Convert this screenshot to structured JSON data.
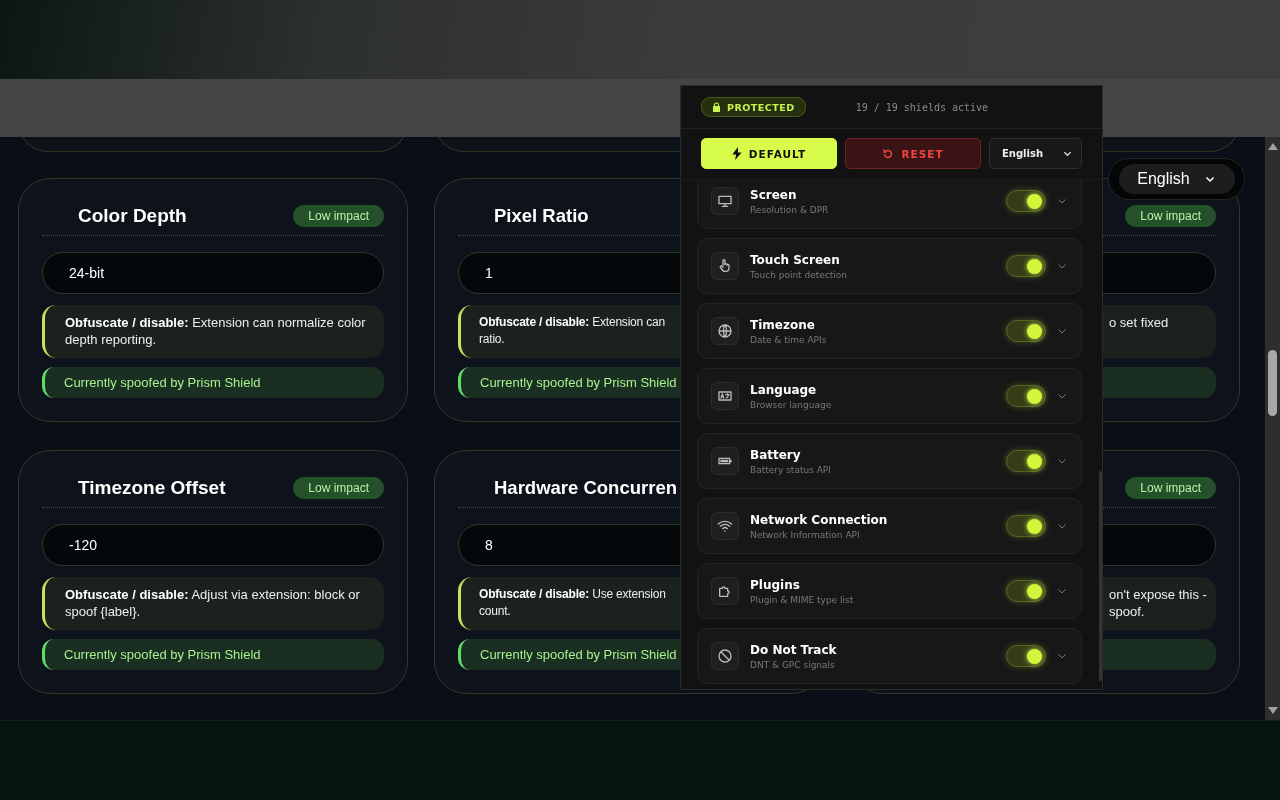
{
  "page": {
    "language_select": {
      "value": "English"
    },
    "cards": [
      {
        "kind": "full",
        "title": "Color Depth",
        "badge": "Low impact",
        "value": "24-bit",
        "note_lines": [
          "**Obfuscate / disable:** Extension can normalize color",
          "depth reporting."
        ],
        "status": "Currently spoofed by Prism Shield"
      },
      {
        "kind": "clipped_right",
        "title": "Pixel Ratio",
        "value": "1",
        "note_lines": [
          "**Obfuscate / disable:** Extension can",
          "ratio."
        ],
        "status": "Currently spoofed by Prism Shield"
      },
      {
        "kind": "clipped_left",
        "badge": "Low impact",
        "note_lines": [
          "o set fixed"
        ]
      },
      {
        "kind": "full",
        "title": "Timezone Offset",
        "badge": "Low impact",
        "value": "-120",
        "note_lines": [
          "**Obfuscate / disable:** Adjust via extension: block or",
          "spoof {label}."
        ],
        "status": "Currently spoofed by Prism Shield"
      },
      {
        "kind": "clipped_right",
        "title": "Hardware Concurren",
        "value": "8",
        "note_lines": [
          "**Obfuscate / disable:** Use extension",
          "count."
        ],
        "status": "Currently spoofed by Prism Shield"
      },
      {
        "kind": "clipped_left",
        "badge": "Low impact",
        "note_lines": [
          "on't expose this -",
          "spoof."
        ]
      }
    ]
  },
  "popup": {
    "status_badge": "PROTECTED",
    "shields": "19 / 19 shields active",
    "buttons": [
      {
        "kind": "default",
        "label": "DEFAULT"
      },
      {
        "kind": "reset",
        "label": "RESET"
      }
    ],
    "language_select": {
      "value": "English"
    },
    "shields_list": [
      {
        "title": "Screen",
        "subtitle": "Resolution & DPR",
        "on": true
      },
      {
        "title": "Touch Screen",
        "subtitle": "Touch point detection",
        "on": true
      },
      {
        "title": "Timezone",
        "subtitle": "Date & time APIs",
        "on": true
      },
      {
        "title": "Language",
        "subtitle": "Browser language",
        "on": true
      },
      {
        "title": "Battery",
        "subtitle": "Battery status API",
        "on": true
      },
      {
        "title": "Network Connection",
        "subtitle": "Network Information API",
        "on": true
      },
      {
        "title": "Plugins",
        "subtitle": "Plugin & MIME type list",
        "on": true
      },
      {
        "title": "Do Not Track",
        "subtitle": "DNT & GPC signals",
        "on": true
      }
    ]
  }
}
